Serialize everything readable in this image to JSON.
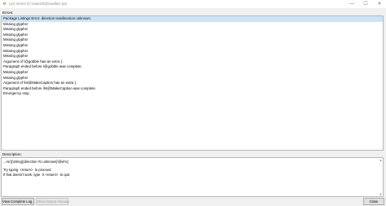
{
  "window": {
    "title": "LyX: Errors (C:\\Users\\li\\Q\\newfile1.lyx)",
    "minimize_glyph": "—",
    "maximize_glyph": "☐",
    "close_glyph": "✕",
    "icon": "lyx-app-icon"
  },
  "errors_label": "Errors:",
  "errors": [
    "Package Listings Error: direction textdirection unknown.",
    "Missing glyphs!",
    "Missing glyphs!",
    "Missing glyphs!",
    "Missing glyphs!",
    "Missing glyphs!",
    "Missing glyphs!",
    "Missing glyphs!",
    "Argument of \\@gobble has an extra }.",
    "Paragraph ended before \\@gobble was complete.",
    "Missing glyphs!",
    "Missing glyphs!",
    "Argument of \\lst@MakeCaption has an extra }.",
    "Paragraph ended before \\lst@MakeCaption was complete.",
    "Emergency stop"
  ],
  "selected_error_index": 0,
  "description_label": "Description:",
  "description_text": "...ror}{\\string}{direction #1 unknown}\\@ehc}\n\nTry typing  <return>  to proceed.\nIf that doesn't work, type  X <return>  to quit.",
  "buttons": {
    "view_log": "View Complete Log...",
    "show_output": "Show Output Anyway",
    "close": "Close"
  },
  "colors": {
    "selection": "#cce4f7",
    "accent_icon": "#e86a1c"
  }
}
